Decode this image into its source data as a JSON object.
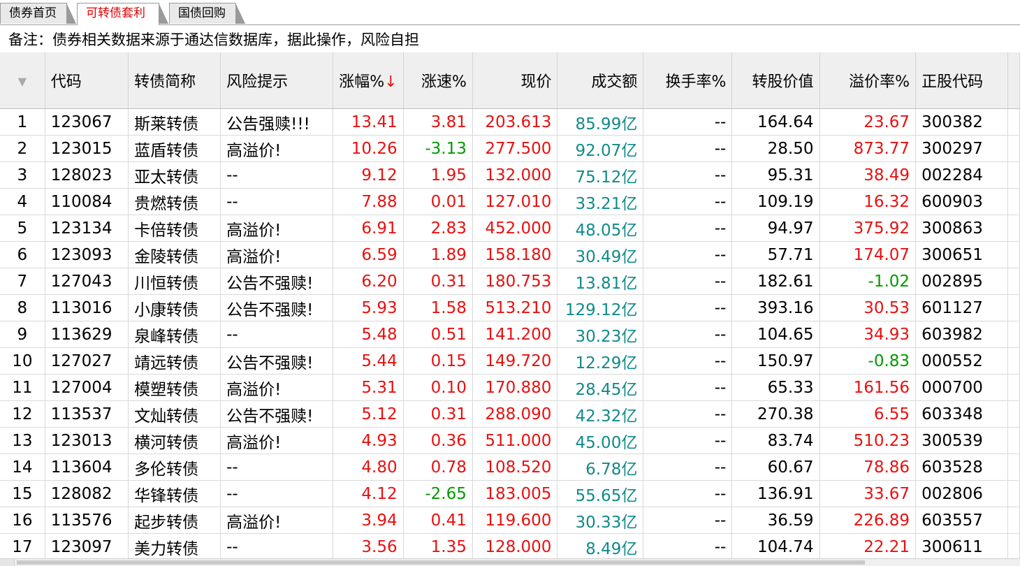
{
  "tabs": [
    {
      "label": "债券首页"
    },
    {
      "label": "可转债套利"
    },
    {
      "label": "国债回购"
    }
  ],
  "note": "备注：债券相关数据来源于通达信数据库，据此操作，风险自担",
  "columns": {
    "code": "代码",
    "name": "转债简称",
    "risk": "风险提示",
    "change": "涨幅%",
    "change_sort": "↓",
    "speed": "涨速%",
    "price": "现价",
    "amount": "成交额",
    "turnover": "换手率%",
    "conv_value": "转股价值",
    "premium": "溢价率%",
    "stock_code": "正股代码"
  },
  "rows": [
    {
      "idx": "1",
      "code": "123067",
      "name": "斯莱转债",
      "risk": "公告强赎!!!",
      "change": "13.41",
      "speed": "3.81",
      "price": "203.613",
      "amount": "85.99亿",
      "turnover": "--",
      "conv_value": "164.64",
      "premium": "23.67",
      "stock_code": "300382"
    },
    {
      "idx": "2",
      "code": "123015",
      "name": "蓝盾转债",
      "risk": "高溢价!",
      "change": "10.26",
      "speed": "-3.13",
      "price": "277.500",
      "amount": "92.07亿",
      "turnover": "--",
      "conv_value": "28.50",
      "premium": "873.77",
      "stock_code": "300297"
    },
    {
      "idx": "3",
      "code": "128023",
      "name": "亚太转债",
      "risk": "--",
      "change": "9.12",
      "speed": "1.95",
      "price": "132.000",
      "amount": "75.12亿",
      "turnover": "--",
      "conv_value": "95.31",
      "premium": "38.49",
      "stock_code": "002284"
    },
    {
      "idx": "4",
      "code": "110084",
      "name": "贵燃转债",
      "risk": "--",
      "change": "7.88",
      "speed": "0.01",
      "price": "127.010",
      "amount": "33.21亿",
      "turnover": "--",
      "conv_value": "109.19",
      "premium": "16.32",
      "stock_code": "600903"
    },
    {
      "idx": "5",
      "code": "123134",
      "name": "卡倍转债",
      "risk": "高溢价!",
      "change": "6.91",
      "speed": "2.83",
      "price": "452.000",
      "amount": "48.05亿",
      "turnover": "--",
      "conv_value": "94.97",
      "premium": "375.92",
      "stock_code": "300863"
    },
    {
      "idx": "6",
      "code": "123093",
      "name": "金陵转债",
      "risk": "高溢价!",
      "change": "6.59",
      "speed": "1.89",
      "price": "158.180",
      "amount": "30.49亿",
      "turnover": "--",
      "conv_value": "57.71",
      "premium": "174.07",
      "stock_code": "300651"
    },
    {
      "idx": "7",
      "code": "127043",
      "name": "川恒转债",
      "risk": "公告不强赎!",
      "change": "6.20",
      "speed": "0.31",
      "price": "180.753",
      "amount": "13.81亿",
      "turnover": "--",
      "conv_value": "182.61",
      "premium": "-1.02",
      "stock_code": "002895"
    },
    {
      "idx": "8",
      "code": "113016",
      "name": "小康转债",
      "risk": "公告不强赎!",
      "change": "5.93",
      "speed": "1.58",
      "price": "513.210",
      "amount": "129.12亿",
      "turnover": "--",
      "conv_value": "393.16",
      "premium": "30.53",
      "stock_code": "601127"
    },
    {
      "idx": "9",
      "code": "113629",
      "name": "泉峰转债",
      "risk": "--",
      "change": "5.48",
      "speed": "0.51",
      "price": "141.200",
      "amount": "30.23亿",
      "turnover": "--",
      "conv_value": "104.65",
      "premium": "34.93",
      "stock_code": "603982"
    },
    {
      "idx": "10",
      "code": "127027",
      "name": "靖远转债",
      "risk": "公告不强赎!",
      "change": "5.44",
      "speed": "0.15",
      "price": "149.720",
      "amount": "12.29亿",
      "turnover": "--",
      "conv_value": "150.97",
      "premium": "-0.83",
      "stock_code": "000552"
    },
    {
      "idx": "11",
      "code": "127004",
      "name": "模塑转债",
      "risk": "高溢价!",
      "change": "5.31",
      "speed": "0.10",
      "price": "170.880",
      "amount": "28.45亿",
      "turnover": "--",
      "conv_value": "65.33",
      "premium": "161.56",
      "stock_code": "000700"
    },
    {
      "idx": "12",
      "code": "113537",
      "name": "文灿转债",
      "risk": "公告不强赎!",
      "change": "5.12",
      "speed": "0.31",
      "price": "288.090",
      "amount": "42.32亿",
      "turnover": "--",
      "conv_value": "270.38",
      "premium": "6.55",
      "stock_code": "603348"
    },
    {
      "idx": "13",
      "code": "123013",
      "name": "横河转债",
      "risk": "高溢价!",
      "change": "4.93",
      "speed": "0.36",
      "price": "511.000",
      "amount": "45.00亿",
      "turnover": "--",
      "conv_value": "83.74",
      "premium": "510.23",
      "stock_code": "300539"
    },
    {
      "idx": "14",
      "code": "113604",
      "name": "多伦转债",
      "risk": "--",
      "change": "4.80",
      "speed": "0.78",
      "price": "108.520",
      "amount": "6.78亿",
      "turnover": "--",
      "conv_value": "60.67",
      "premium": "78.86",
      "stock_code": "603528"
    },
    {
      "idx": "15",
      "code": "128082",
      "name": "华锋转债",
      "risk": "--",
      "change": "4.12",
      "speed": "-2.65",
      "price": "183.005",
      "amount": "55.65亿",
      "turnover": "--",
      "conv_value": "136.91",
      "premium": "33.67",
      "stock_code": "002806"
    },
    {
      "idx": "16",
      "code": "113576",
      "name": "起步转债",
      "risk": "高溢价!",
      "change": "3.94",
      "speed": "0.41",
      "price": "119.600",
      "amount": "30.33亿",
      "turnover": "--",
      "conv_value": "36.59",
      "premium": "226.89",
      "stock_code": "603557"
    },
    {
      "idx": "17",
      "code": "123097",
      "name": "美力转债",
      "risk": "--",
      "change": "3.56",
      "speed": "1.35",
      "price": "128.000",
      "amount": "8.49亿",
      "turnover": "--",
      "conv_value": "104.74",
      "premium": "22.21",
      "stock_code": "300611"
    }
  ],
  "colors": {
    "up": "#e81010",
    "down": "#009900",
    "amount": "#118a8a"
  },
  "icons": {
    "header_sort": "caret-down-icon"
  }
}
